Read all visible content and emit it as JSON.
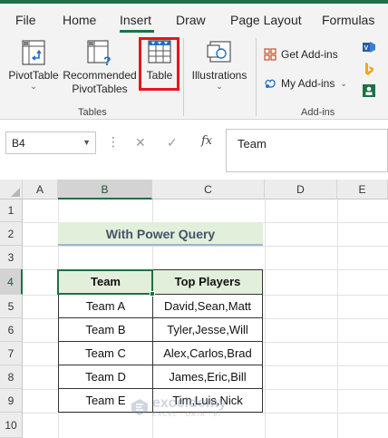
{
  "tabs": [
    "File",
    "Home",
    "Insert",
    "Draw",
    "Page Layout",
    "Formulas"
  ],
  "active_tab": "Insert",
  "ribbon": {
    "pivottable": "PivotTable",
    "recommended_line1": "Recommended",
    "recommended_line2": "PivotTables",
    "table": "Table",
    "illustrations": "Illustrations",
    "get_addins": "Get Add-ins",
    "my_addins": "My Add-ins",
    "group_tables": "Tables",
    "group_addins": "Add-ins"
  },
  "formula_bar": {
    "namebox": "B4",
    "fx": "fx",
    "content": "Team"
  },
  "columns": [
    "A",
    "B",
    "C",
    "D",
    "E"
  ],
  "rows": [
    "1",
    "2",
    "3",
    "4",
    "5",
    "6",
    "7",
    "8",
    "9",
    "10"
  ],
  "sheet": {
    "title": "With Power Query",
    "headers": [
      "Team",
      "Top Players"
    ],
    "data": [
      [
        "Team A",
        "David,Sean,Matt"
      ],
      [
        "Team B",
        "Tyler,Jesse,Will"
      ],
      [
        "Team C",
        "Alex,Carlos,Brad"
      ],
      [
        "Team D",
        "James,Eric,Bill"
      ],
      [
        "Team E",
        "Tim,Luis,Nick"
      ]
    ]
  },
  "watermark": {
    "name": "exceldemy",
    "tagline": "EXCEL · DATA · BI"
  },
  "colors": {
    "excel_green": "#1e7145",
    "highlight_red": "#e8141c",
    "title_fill": "#e2efda",
    "title_text": "#44546a"
  }
}
